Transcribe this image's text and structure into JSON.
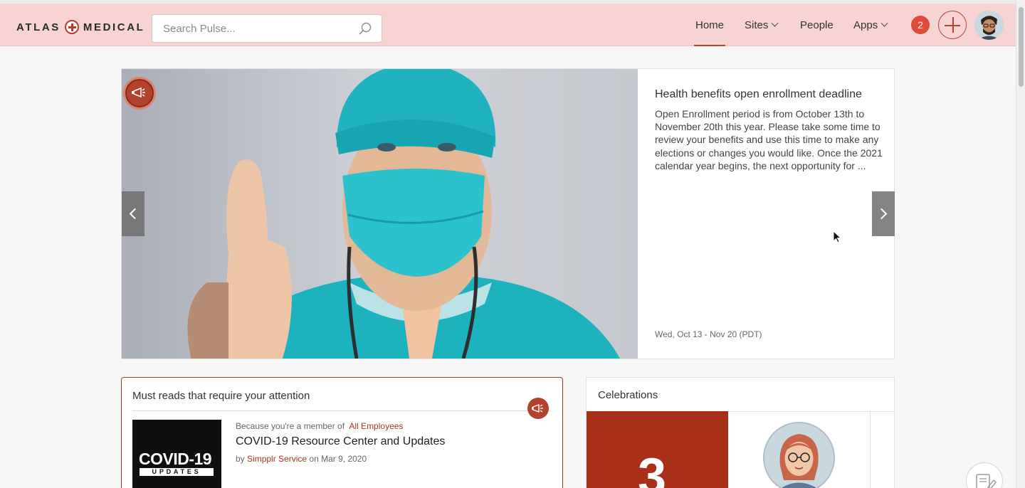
{
  "brand": {
    "name_left": "ATLAS",
    "name_right": "MEDICAL"
  },
  "search": {
    "placeholder": "Search Pulse..."
  },
  "nav": {
    "home": "Home",
    "sites": "Sites",
    "people": "People",
    "apps": "Apps"
  },
  "notifications": {
    "count": "2"
  },
  "hero": {
    "title": "Health benefits open enrollment deadline",
    "body": "Open Enrollment period is from October 13th to November 20th this year. Please take some time to review your benefits and use this time to make any elections or changes you would like. Once the 2021 calendar year begins, the next opportunity for ...",
    "date": "Wed, Oct 13 - Nov 20 (PDT)"
  },
  "must_reads": {
    "title": "Must reads that require your attention",
    "item": {
      "thumb_big": "COVID-19",
      "thumb_small": "UPDATES",
      "meta_prefix": "Because you're a member of",
      "meta_link": "All Employees",
      "headline": "COVID-19 Resource Center and Updates",
      "by_prefix": "by",
      "author": "Simpplr Service",
      "date_prefix": "on",
      "date": "Mar 9, 2020"
    }
  },
  "celebrations": {
    "title": "Celebrations",
    "card_number": "3"
  },
  "colors": {
    "topbar": "#f8d3d3",
    "accent": "#b4432d",
    "notification": "#e04a3b"
  },
  "icons": [
    "search-icon",
    "megaphone-icon",
    "chevron-down-icon",
    "plus-icon",
    "chevron-left-icon",
    "chevron-right-icon",
    "compose-icon",
    "cursor-icon"
  ]
}
